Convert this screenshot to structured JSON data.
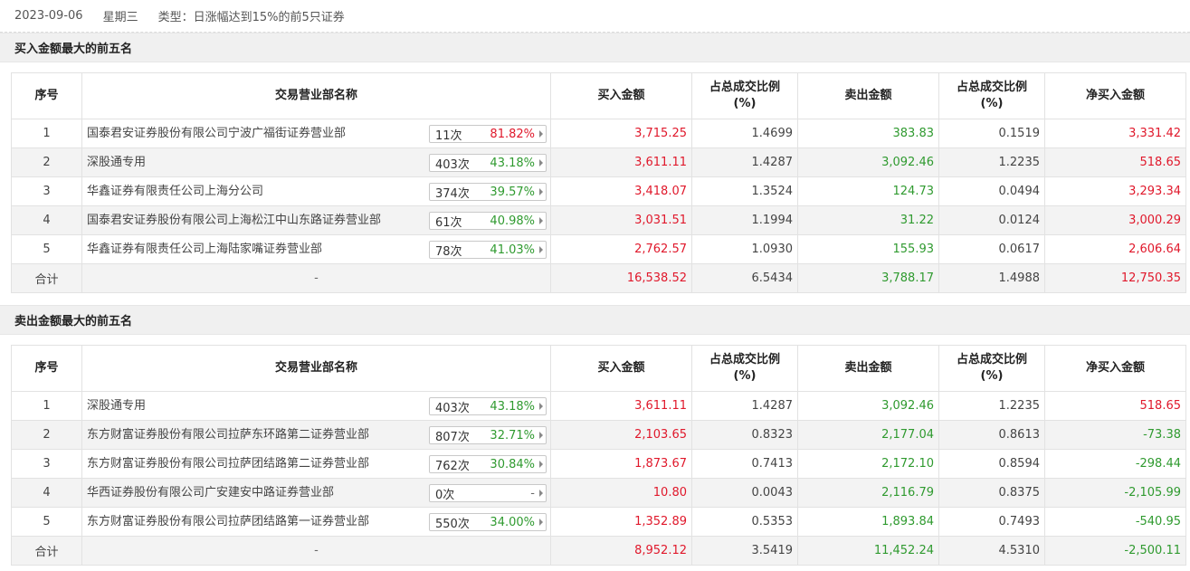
{
  "header": {
    "date": "2023-09-06",
    "weekday": "星期三",
    "type_text": "类型：日涨幅达到15%的前5只证券"
  },
  "columns": {
    "index": "序号",
    "branch": "交易营业部名称",
    "buy_amount": "买入金额",
    "buy_ratio_l1": "占总成交比例",
    "buy_ratio_l2": "(%)",
    "sell_amount": "卖出金额",
    "sell_ratio_l1": "占总成交比例",
    "sell_ratio_l2": "(%)",
    "net_buy": "净买入金额"
  },
  "buy_section": {
    "title": "买入金额最大的前五名",
    "rows": [
      {
        "idx": "1",
        "name": "国泰君安证券股份有限公司宁波广福街证券营业部",
        "count": "11次",
        "pct": "81.82%",
        "pct_color": "red",
        "buy": "3,715.25",
        "buy_ratio": "1.4699",
        "sell": "383.83",
        "sell_ratio": "0.1519",
        "net": "3,331.42",
        "net_color": "red"
      },
      {
        "idx": "2",
        "name": "深股通专用",
        "count": "403次",
        "pct": "43.18%",
        "pct_color": "green",
        "buy": "3,611.11",
        "buy_ratio": "1.4287",
        "sell": "3,092.46",
        "sell_ratio": "1.2235",
        "net": "518.65",
        "net_color": "red"
      },
      {
        "idx": "3",
        "name": "华鑫证券有限责任公司上海分公司",
        "count": "374次",
        "pct": "39.57%",
        "pct_color": "green",
        "buy": "3,418.07",
        "buy_ratio": "1.3524",
        "sell": "124.73",
        "sell_ratio": "0.0494",
        "net": "3,293.34",
        "net_color": "red"
      },
      {
        "idx": "4",
        "name": "国泰君安证券股份有限公司上海松江中山东路证券营业部",
        "count": "61次",
        "pct": "40.98%",
        "pct_color": "green",
        "buy": "3,031.51",
        "buy_ratio": "1.1994",
        "sell": "31.22",
        "sell_ratio": "0.0124",
        "net": "3,000.29",
        "net_color": "red"
      },
      {
        "idx": "5",
        "name": "华鑫证券有限责任公司上海陆家嘴证券营业部",
        "count": "78次",
        "pct": "41.03%",
        "pct_color": "green",
        "buy": "2,762.57",
        "buy_ratio": "1.0930",
        "sell": "155.93",
        "sell_ratio": "0.0617",
        "net": "2,606.64",
        "net_color": "red"
      }
    ],
    "total": {
      "label": "合计",
      "name": "-",
      "buy": "16,538.52",
      "buy_ratio": "6.5434",
      "sell": "3,788.17",
      "sell_ratio": "1.4988",
      "net": "12,750.35",
      "net_color": "red"
    }
  },
  "sell_section": {
    "title": "卖出金额最大的前五名",
    "rows": [
      {
        "idx": "1",
        "name": "深股通专用",
        "count": "403次",
        "pct": "43.18%",
        "pct_color": "green",
        "buy": "3,611.11",
        "buy_ratio": "1.4287",
        "sell": "3,092.46",
        "sell_ratio": "1.2235",
        "net": "518.65",
        "net_color": "red"
      },
      {
        "idx": "2",
        "name": "东方财富证券股份有限公司拉萨东环路第二证券营业部",
        "count": "807次",
        "pct": "32.71%",
        "pct_color": "green",
        "buy": "2,103.65",
        "buy_ratio": "0.8323",
        "sell": "2,177.04",
        "sell_ratio": "0.8613",
        "net": "-73.38",
        "net_color": "green"
      },
      {
        "idx": "3",
        "name": "东方财富证券股份有限公司拉萨团结路第二证券营业部",
        "count": "762次",
        "pct": "30.84%",
        "pct_color": "green",
        "buy": "1,873.67",
        "buy_ratio": "0.7413",
        "sell": "2,172.10",
        "sell_ratio": "0.8594",
        "net": "-298.44",
        "net_color": "green"
      },
      {
        "idx": "4",
        "name": "华西证券股份有限公司广安建安中路证券营业部",
        "count": "0次",
        "pct": "-",
        "pct_color": "gray",
        "buy": "10.80",
        "buy_ratio": "0.0043",
        "sell": "2,116.79",
        "sell_ratio": "0.8375",
        "net": "-2,105.99",
        "net_color": "green"
      },
      {
        "idx": "5",
        "name": "东方财富证券股份有限公司拉萨团结路第一证券营业部",
        "count": "550次",
        "pct": "34.00%",
        "pct_color": "green",
        "buy": "1,352.89",
        "buy_ratio": "0.5353",
        "sell": "1,893.84",
        "sell_ratio": "0.7493",
        "net": "-540.95",
        "net_color": "green"
      }
    ],
    "total": {
      "label": "合计",
      "name": "-",
      "buy": "8,952.12",
      "buy_ratio": "3.5419",
      "sell": "11,452.24",
      "sell_ratio": "4.5310",
      "net": "-2,500.11",
      "net_color": "green"
    }
  }
}
